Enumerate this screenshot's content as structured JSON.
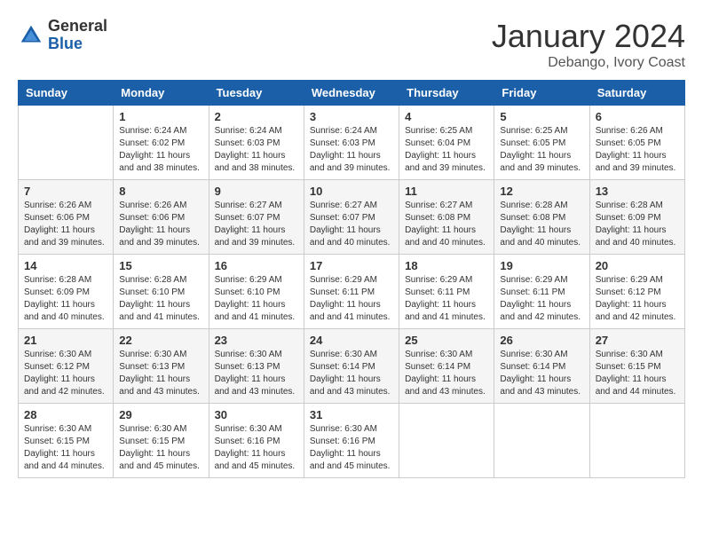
{
  "header": {
    "logo_general": "General",
    "logo_blue": "Blue",
    "month_title": "January 2024",
    "location": "Debango, Ivory Coast"
  },
  "weekdays": [
    "Sunday",
    "Monday",
    "Tuesday",
    "Wednesday",
    "Thursday",
    "Friday",
    "Saturday"
  ],
  "weeks": [
    [
      {
        "day": "",
        "sunrise": "",
        "sunset": "",
        "daylight": ""
      },
      {
        "day": "1",
        "sunrise": "Sunrise: 6:24 AM",
        "sunset": "Sunset: 6:02 PM",
        "daylight": "Daylight: 11 hours and 38 minutes."
      },
      {
        "day": "2",
        "sunrise": "Sunrise: 6:24 AM",
        "sunset": "Sunset: 6:03 PM",
        "daylight": "Daylight: 11 hours and 38 minutes."
      },
      {
        "day": "3",
        "sunrise": "Sunrise: 6:24 AM",
        "sunset": "Sunset: 6:03 PM",
        "daylight": "Daylight: 11 hours and 39 minutes."
      },
      {
        "day": "4",
        "sunrise": "Sunrise: 6:25 AM",
        "sunset": "Sunset: 6:04 PM",
        "daylight": "Daylight: 11 hours and 39 minutes."
      },
      {
        "day": "5",
        "sunrise": "Sunrise: 6:25 AM",
        "sunset": "Sunset: 6:05 PM",
        "daylight": "Daylight: 11 hours and 39 minutes."
      },
      {
        "day": "6",
        "sunrise": "Sunrise: 6:26 AM",
        "sunset": "Sunset: 6:05 PM",
        "daylight": "Daylight: 11 hours and 39 minutes."
      }
    ],
    [
      {
        "day": "7",
        "sunrise": "Sunrise: 6:26 AM",
        "sunset": "Sunset: 6:06 PM",
        "daylight": "Daylight: 11 hours and 39 minutes."
      },
      {
        "day": "8",
        "sunrise": "Sunrise: 6:26 AM",
        "sunset": "Sunset: 6:06 PM",
        "daylight": "Daylight: 11 hours and 39 minutes."
      },
      {
        "day": "9",
        "sunrise": "Sunrise: 6:27 AM",
        "sunset": "Sunset: 6:07 PM",
        "daylight": "Daylight: 11 hours and 39 minutes."
      },
      {
        "day": "10",
        "sunrise": "Sunrise: 6:27 AM",
        "sunset": "Sunset: 6:07 PM",
        "daylight": "Daylight: 11 hours and 40 minutes."
      },
      {
        "day": "11",
        "sunrise": "Sunrise: 6:27 AM",
        "sunset": "Sunset: 6:08 PM",
        "daylight": "Daylight: 11 hours and 40 minutes."
      },
      {
        "day": "12",
        "sunrise": "Sunrise: 6:28 AM",
        "sunset": "Sunset: 6:08 PM",
        "daylight": "Daylight: 11 hours and 40 minutes."
      },
      {
        "day": "13",
        "sunrise": "Sunrise: 6:28 AM",
        "sunset": "Sunset: 6:09 PM",
        "daylight": "Daylight: 11 hours and 40 minutes."
      }
    ],
    [
      {
        "day": "14",
        "sunrise": "Sunrise: 6:28 AM",
        "sunset": "Sunset: 6:09 PM",
        "daylight": "Daylight: 11 hours and 40 minutes."
      },
      {
        "day": "15",
        "sunrise": "Sunrise: 6:28 AM",
        "sunset": "Sunset: 6:10 PM",
        "daylight": "Daylight: 11 hours and 41 minutes."
      },
      {
        "day": "16",
        "sunrise": "Sunrise: 6:29 AM",
        "sunset": "Sunset: 6:10 PM",
        "daylight": "Daylight: 11 hours and 41 minutes."
      },
      {
        "day": "17",
        "sunrise": "Sunrise: 6:29 AM",
        "sunset": "Sunset: 6:11 PM",
        "daylight": "Daylight: 11 hours and 41 minutes."
      },
      {
        "day": "18",
        "sunrise": "Sunrise: 6:29 AM",
        "sunset": "Sunset: 6:11 PM",
        "daylight": "Daylight: 11 hours and 41 minutes."
      },
      {
        "day": "19",
        "sunrise": "Sunrise: 6:29 AM",
        "sunset": "Sunset: 6:11 PM",
        "daylight": "Daylight: 11 hours and 42 minutes."
      },
      {
        "day": "20",
        "sunrise": "Sunrise: 6:29 AM",
        "sunset": "Sunset: 6:12 PM",
        "daylight": "Daylight: 11 hours and 42 minutes."
      }
    ],
    [
      {
        "day": "21",
        "sunrise": "Sunrise: 6:30 AM",
        "sunset": "Sunset: 6:12 PM",
        "daylight": "Daylight: 11 hours and 42 minutes."
      },
      {
        "day": "22",
        "sunrise": "Sunrise: 6:30 AM",
        "sunset": "Sunset: 6:13 PM",
        "daylight": "Daylight: 11 hours and 43 minutes."
      },
      {
        "day": "23",
        "sunrise": "Sunrise: 6:30 AM",
        "sunset": "Sunset: 6:13 PM",
        "daylight": "Daylight: 11 hours and 43 minutes."
      },
      {
        "day": "24",
        "sunrise": "Sunrise: 6:30 AM",
        "sunset": "Sunset: 6:14 PM",
        "daylight": "Daylight: 11 hours and 43 minutes."
      },
      {
        "day": "25",
        "sunrise": "Sunrise: 6:30 AM",
        "sunset": "Sunset: 6:14 PM",
        "daylight": "Daylight: 11 hours and 43 minutes."
      },
      {
        "day": "26",
        "sunrise": "Sunrise: 6:30 AM",
        "sunset": "Sunset: 6:14 PM",
        "daylight": "Daylight: 11 hours and 43 minutes."
      },
      {
        "day": "27",
        "sunrise": "Sunrise: 6:30 AM",
        "sunset": "Sunset: 6:15 PM",
        "daylight": "Daylight: 11 hours and 44 minutes."
      }
    ],
    [
      {
        "day": "28",
        "sunrise": "Sunrise: 6:30 AM",
        "sunset": "Sunset: 6:15 PM",
        "daylight": "Daylight: 11 hours and 44 minutes."
      },
      {
        "day": "29",
        "sunrise": "Sunrise: 6:30 AM",
        "sunset": "Sunset: 6:15 PM",
        "daylight": "Daylight: 11 hours and 45 minutes."
      },
      {
        "day": "30",
        "sunrise": "Sunrise: 6:30 AM",
        "sunset": "Sunset: 6:16 PM",
        "daylight": "Daylight: 11 hours and 45 minutes."
      },
      {
        "day": "31",
        "sunrise": "Sunrise: 6:30 AM",
        "sunset": "Sunset: 6:16 PM",
        "daylight": "Daylight: 11 hours and 45 minutes."
      },
      {
        "day": "",
        "sunrise": "",
        "sunset": "",
        "daylight": ""
      },
      {
        "day": "",
        "sunrise": "",
        "sunset": "",
        "daylight": ""
      },
      {
        "day": "",
        "sunrise": "",
        "sunset": "",
        "daylight": ""
      }
    ]
  ]
}
